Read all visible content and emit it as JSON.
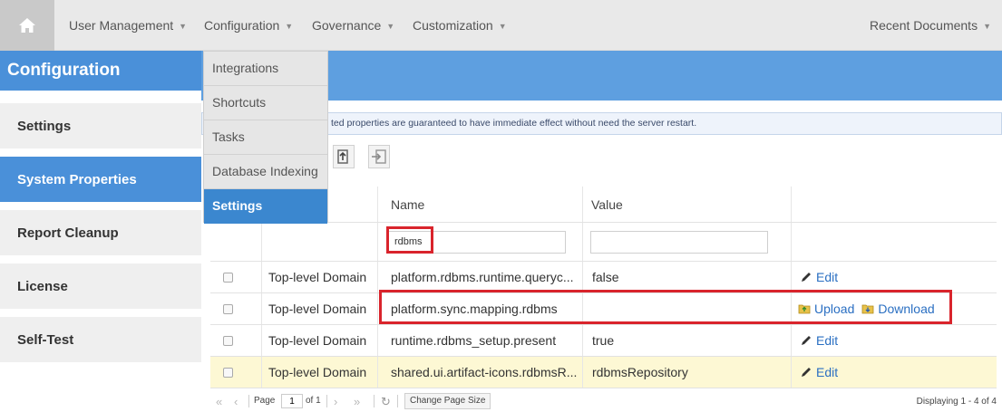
{
  "topnav": {
    "home_icon": "home-icon",
    "items": [
      {
        "label": "User Management"
      },
      {
        "label": "Configuration"
      },
      {
        "label": "Governance"
      },
      {
        "label": "Customization"
      }
    ],
    "recent": "Recent Documents"
  },
  "sidebar": {
    "title": "Configuration",
    "items": [
      {
        "label": "Settings"
      },
      {
        "label": "System Properties",
        "active": true
      },
      {
        "label": "Report Cleanup"
      },
      {
        "label": "License"
      },
      {
        "label": "Self-Test"
      }
    ]
  },
  "dropdown": {
    "items": [
      {
        "label": "Integrations"
      },
      {
        "label": "Shortcuts"
      },
      {
        "label": "Tasks"
      },
      {
        "label": "Database Indexing"
      },
      {
        "label": "Settings",
        "active": true
      }
    ]
  },
  "info_text": "ted properties are guaranteed to have immediate effect without need the server restart.",
  "table": {
    "headers": {
      "name": "Name",
      "value": "Value"
    },
    "filter": {
      "name": "rdbms",
      "value": ""
    },
    "rows": [
      {
        "domain": "Top-level Domain",
        "name": "platform.rdbms.runtime.queryc...",
        "value": "false",
        "actions": [
          "Edit"
        ]
      },
      {
        "domain": "Top-level Domain",
        "name": "platform.sync.mapping.rdbms",
        "value": "",
        "actions": [
          "Upload",
          "Download"
        ]
      },
      {
        "domain": "Top-level Domain",
        "name": "runtime.rdbms_setup.present",
        "value": "true",
        "actions": [
          "Edit"
        ]
      },
      {
        "domain": "Top-level Domain",
        "name": "shared.ui.artifact-icons.rdbmsR...",
        "value": "rdbmsRepository",
        "actions": [
          "Edit"
        ],
        "highlighted": true
      }
    ]
  },
  "pager": {
    "page_label": "Page",
    "page_value": "1",
    "of_label": "of 1",
    "change_size": "Change Page Size",
    "displaying": "Displaying 1 - 4 of 4"
  },
  "colors": {
    "accent": "#4a90d9",
    "highlight_row": "#fdf8d4",
    "annotation": "#d9242c",
    "link": "#2a6fc2"
  }
}
